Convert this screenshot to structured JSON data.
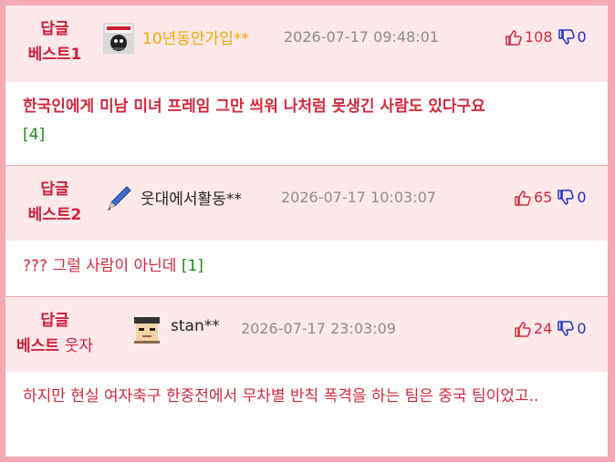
{
  "comments": [
    {
      "rank_top": "답글",
      "rank_bottom": "베스트1",
      "rank_suffix": "",
      "nickname": "10년동안가입**",
      "date": "2026-07-17 09:48:01",
      "likes": "108",
      "dislikes": "0",
      "text": "한국인에게 미남 미녀 프레임 그만 씌워 나처럼 못생긴 사람도 있다구요",
      "replies": "[4]"
    },
    {
      "rank_top": "답글",
      "rank_bottom": "베스트2",
      "rank_suffix": "",
      "nickname": "웃대에서활동**",
      "date": "2026-07-17 10:03:07",
      "likes": "65",
      "dislikes": "0",
      "text": "??? 그럴 사람이 아닌데",
      "replies": "[1]"
    },
    {
      "rank_top": "답글",
      "rank_bottom": "베스트",
      "rank_suffix": "웃자",
      "nickname": "stan**",
      "date": "2026-07-17 23:03:09",
      "likes": "24",
      "dislikes": "0",
      "text": "하지만 현실 여자축구 한중전에서 무차별 반칙 폭격을 하는 팀은 중국 팀이었고..",
      "replies": ""
    }
  ],
  "colors": {
    "accent": "#d6283d",
    "header_bg": "#fde8ea",
    "border": "#f4a9b4",
    "gold_nick": "#f0a800",
    "reply_green": "#1f8a1f",
    "dislike_blue": "#1e2dc8"
  }
}
